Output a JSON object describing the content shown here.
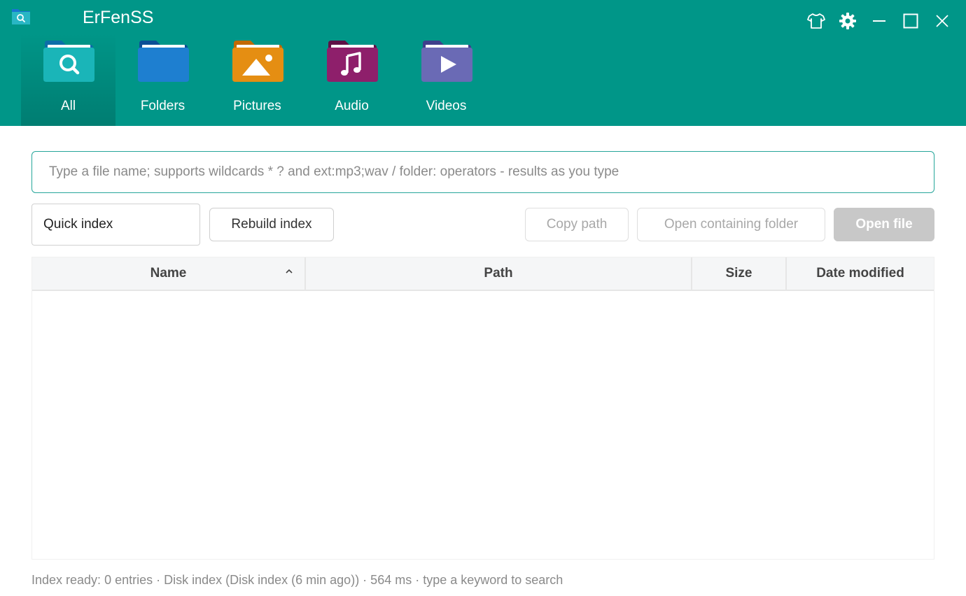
{
  "app": {
    "title": "ErFenSS"
  },
  "window_controls": [
    {
      "name": "skin-icon"
    },
    {
      "name": "settings-icon"
    },
    {
      "name": "minimize-icon"
    },
    {
      "name": "maximize-icon"
    },
    {
      "name": "close-icon"
    }
  ],
  "nav": {
    "active": "All",
    "tabs": [
      {
        "label": "All",
        "icon": "search-folder-icon",
        "color": "#17b3b8"
      },
      {
        "label": "Folders",
        "icon": "folder-icon",
        "color": "#1e7fd0"
      },
      {
        "label": "Pictures",
        "icon": "picture-folder-icon",
        "color": "#e58e12"
      },
      {
        "label": "Audio",
        "icon": "audio-folder-icon",
        "color": "#8e1f6b"
      },
      {
        "label": "Videos",
        "icon": "video-folder-icon",
        "color": "#6a6ab5"
      }
    ]
  },
  "search": {
    "value": "",
    "placeholder": "Type a file name; supports wildcards * ? and ext:mp3;wav / folder: operators - results as you type"
  },
  "toolbar": {
    "index_mode": "Quick index",
    "rebuild_label": "Rebuild index",
    "copy_path_label": "Copy path",
    "open_folder_label": "Open containing folder",
    "open_file_label": "Open file"
  },
  "table": {
    "columns": [
      "Name",
      "Path",
      "Size",
      "Date modified"
    ],
    "sort_column": "Name",
    "sort_direction": "ascending",
    "rows": []
  },
  "status": {
    "text": "Index ready: 0 entries · Disk index (Disk index (6 min ago)) · 564 ms · type a keyword to search"
  },
  "colors": {
    "header_bg": "#009688",
    "accent": "#26a69a"
  }
}
